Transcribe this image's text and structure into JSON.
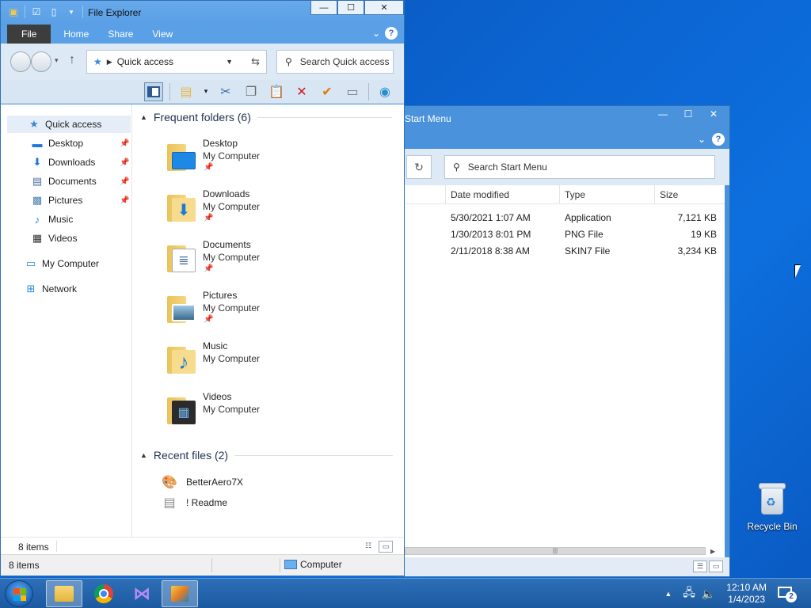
{
  "desktop": {
    "recycle_bin_label": "Recycle Bin"
  },
  "start_menu_window": {
    "title": "Start Menu",
    "search_placeholder": "Search Start Menu",
    "columns": [
      "Date modified",
      "Type",
      "Size"
    ],
    "rows": [
      {
        "date": "5/30/2021 1:07 AM",
        "type": "Application",
        "size": "7,121 KB"
      },
      {
        "date": "1/30/2013 8:01 PM",
        "type": "PNG File",
        "size": "19 KB"
      },
      {
        "date": "2/11/2018 8:38 AM",
        "type": "SKIN7 File",
        "size": "3,234 KB"
      }
    ]
  },
  "explorer": {
    "title": "File Explorer",
    "tabs": [
      "File",
      "Home",
      "Share",
      "View"
    ],
    "address": "Quick access",
    "search_placeholder": "Search Quick access",
    "nav": {
      "quick_access": "Quick access",
      "pinned": [
        "Desktop",
        "Downloads",
        "Documents",
        "Pictures"
      ],
      "other": [
        "Music",
        "Videos"
      ],
      "my_computer": "My Computer",
      "network": "Network"
    },
    "frequent_header": "Frequent folders (6)",
    "frequent": [
      {
        "name": "Desktop",
        "location": "My Computer",
        "icon": "desktop-icon"
      },
      {
        "name": "Downloads",
        "location": "My Computer",
        "icon": "download-arrow-icon"
      },
      {
        "name": "Documents",
        "location": "My Computer",
        "icon": "document-icon"
      },
      {
        "name": "Pictures",
        "location": "My Computer",
        "icon": "picture-icon"
      },
      {
        "name": "Music",
        "location": "My Computer",
        "icon": "music-note-icon"
      },
      {
        "name": "Videos",
        "location": "My Computer",
        "icon": "film-icon"
      }
    ],
    "recent_header": "Recent files (2)",
    "recent": [
      "BetterAero7X",
      "! Readme"
    ],
    "status_items": "8 items",
    "status_items_bottom": "8 items",
    "status_location": "Computer"
  },
  "taskbar": {
    "time": "12:10 AM",
    "date": "1/4/2023",
    "notifications": "2"
  },
  "colors": {
    "accent": "#5aa0e6",
    "desktop": "#0b63cf"
  }
}
